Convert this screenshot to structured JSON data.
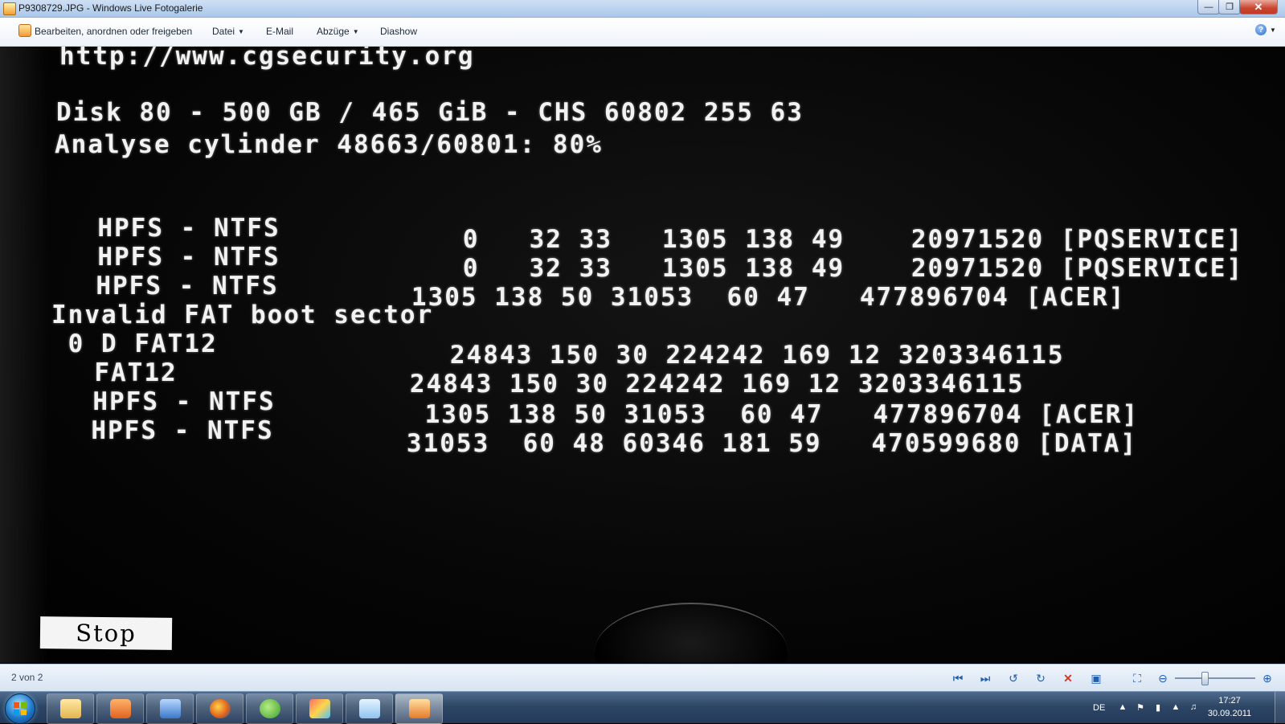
{
  "window": {
    "title": "P9308729.JPG - Windows Live Fotogalerie",
    "minimize_icon": "minimize-icon",
    "maximize_icon": "restore-icon",
    "close_icon": "close-icon"
  },
  "menu": {
    "fix_label": "Bearbeiten, anordnen oder freigeben",
    "file_label": "Datei",
    "email_label": "E-Mail",
    "prints_label": "Abzüge",
    "slideshow_label": "Diashow",
    "help_icon": "help-icon"
  },
  "photo": {
    "lines": [
      "http://www.cgsecurity.org",
      "Disk 80 - 500 GB / 465 GiB - CHS 60802 255 63",
      "Analyse cylinder 48663/60801: 80%",
      "  HPFS - NTFS",
      "                        0   32 33   1305 138 49    20971520 [PQSERVICE]",
      "  HPFS - NTFS",
      "                        0   32 33   1305 138 49    20971520 [PQSERVICE]",
      "  HPFS - NTFS",
      "                     1305 138 50 31053  60 47   477896704 [ACER]",
      "Invalid FAT boot sector",
      " 0 D FAT12",
      "                        24843 150 30 224242 169 12 3203346115",
      "  FAT12",
      "                     24843 150 30 224242 169 12 3203346115",
      "  HPFS - NTFS",
      "                      1305 138 50 31053  60 47   477896704 [ACER]",
      "  HPFS - NTFS",
      "                     31053  60 48 60346 181 59   470599680 [DATA]"
    ],
    "stop_label": "Stop"
  },
  "viewer": {
    "page_count": "2 von 2",
    "icons": [
      "previous-icon",
      "next-icon",
      "rotate-left-icon",
      "rotate-right-icon",
      "delete-icon",
      "slideshow-icon",
      "actual-size-icon",
      "zoom-out-icon",
      "zoom-in-icon"
    ],
    "zoom_level": 0.35
  },
  "taskbar": {
    "apps": [
      "explorer-icon",
      "media-player-icon",
      "photo-editor-icon",
      "firefox-icon",
      "messenger-icon",
      "paint-icon",
      "notes-icon",
      "photo-gallery-icon"
    ],
    "language": "DE",
    "time": "17:27",
    "date": "30.09.2011"
  },
  "colors": {
    "titlebar": "#b9d1ee",
    "screen_text": "#f2f2f2",
    "taskbar": "#2e4766"
  }
}
